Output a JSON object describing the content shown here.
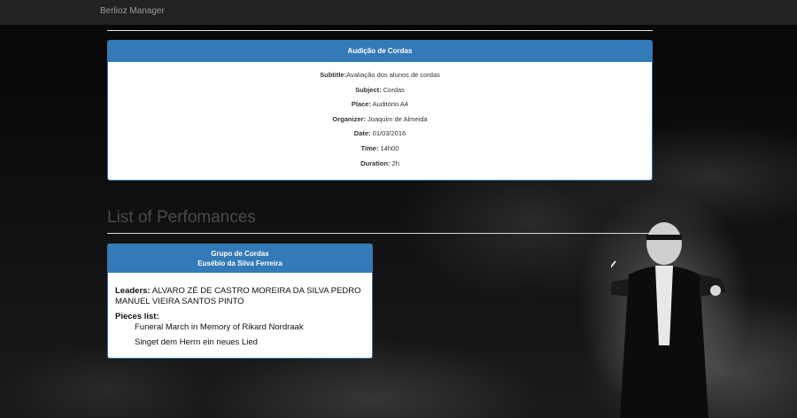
{
  "app": {
    "brand": "Berlioz Manager"
  },
  "event": {
    "title": "Audição de Cordas",
    "fields": [
      {
        "label": "Subtitle:",
        "value": "Avaliação dos alunos de cordas"
      },
      {
        "label": "Subject:",
        "value": " Cordas"
      },
      {
        "label": "Place:",
        "value": " Auditório A4"
      },
      {
        "label": "Organizer:",
        "value": " Joaquim de Almeida"
      },
      {
        "label": "Date:",
        "value": " 01/03/2016"
      },
      {
        "label": "Time:",
        "value": " 14h00"
      },
      {
        "label": "Duration:",
        "value": " 2h"
      }
    ]
  },
  "performances": {
    "section_title": "List of Perfomances",
    "items": [
      {
        "group": "Grupo de Cordas",
        "person": "Eusébio da Silva Ferreira",
        "leaders_label": "Leaders:",
        "leaders": " ALVARO ZÉ DE CASTRO MOREIRA DA SILVA PEDRO MANUEL VIEIRA SANTOS PINTO",
        "pieces_label": "Pieces list:",
        "pieces": [
          "Funeral March in Memory of Rikard Nordraak",
          "Singet dem Herrn ein neues Lied"
        ]
      }
    ]
  },
  "colors": {
    "primary": "#337ab7",
    "navbar": "#222222"
  }
}
